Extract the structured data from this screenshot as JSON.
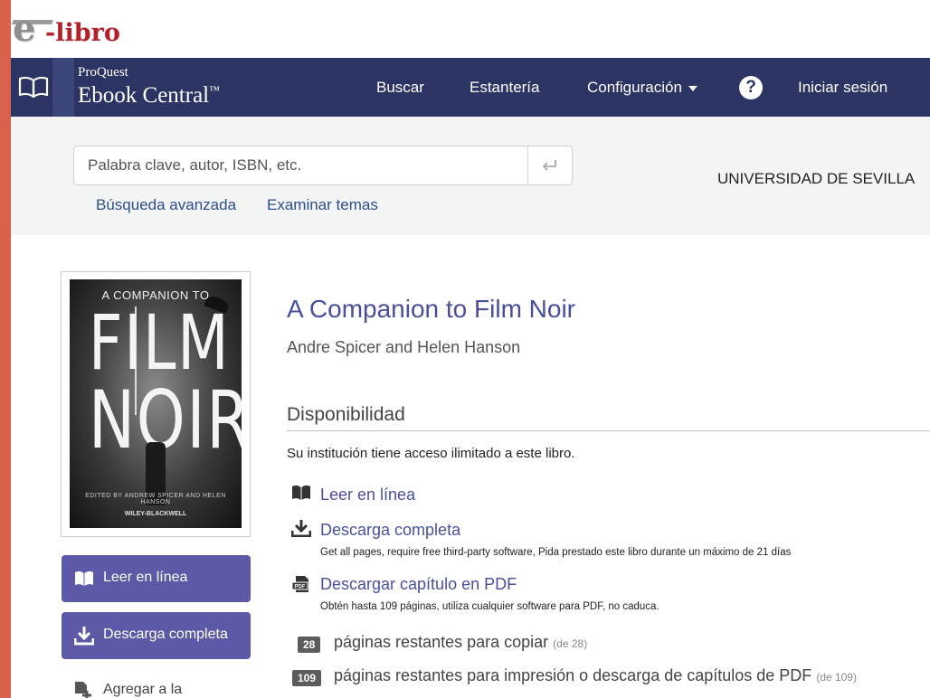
{
  "logo": {
    "letter": "e",
    "text": "-libro"
  },
  "nav": {
    "brand_small": "ProQuest",
    "brand_big": "Ebook Central",
    "trademark": "™",
    "links": [
      "Buscar",
      "Estantería",
      "Configuración",
      "Iniciar sesión"
    ],
    "help_symbol": "?",
    "icons": {
      "library": "open-book-icon",
      "help": "question-circle-icon",
      "dropdown": "caret-down-icon"
    }
  },
  "search": {
    "placeholder": "Palabra clave, autor, ISBN, etc.",
    "value": "",
    "submit_icon": "enter-return-icon",
    "advanced": "Búsqueda avanzada",
    "browse": "Examinar temas"
  },
  "institution": "UNIVERSIDAD DE SEVILLA",
  "cover": {
    "top_line": "A COMPANION TO",
    "line1": "FILM",
    "line2": "NOIR",
    "edited": "EDITED BY ANDREW SPICER AND HELEN HANSON",
    "publisher": "WILEY-BLACKWELL"
  },
  "actions": {
    "read_online": "Leer en línea",
    "download_full": "Descarga completa",
    "add_to": "Agregar a la"
  },
  "book": {
    "title": "A Companion to Film Noir",
    "authors": "Andre Spicer and Helen Hanson"
  },
  "availability": {
    "heading": "Disponibilidad",
    "access_text": "Su institución tiene acceso ilimitado a este libro.",
    "options": [
      {
        "label": "Leer en línea",
        "icon": "book-icon",
        "sub": ""
      },
      {
        "label": "Descarga completa",
        "icon": "download-icon",
        "sub": "Get all pages, require free third-party software, Pida prestado este libro durante un máximo de 21 días"
      },
      {
        "label": "Descargar capítulo en PDF",
        "icon": "pdf-icon",
        "sub": "Obtén hasta 109 páginas, utiliza cualquier software para PDF, no caduca."
      }
    ],
    "copy": {
      "count": "28",
      "text": "páginas restantes para copiar",
      "total": "(de 28)"
    },
    "print": {
      "count": "109",
      "text": "páginas restantes para impresión o descarga de capítulos de PDF",
      "total": "(de 109)"
    }
  },
  "colors": {
    "nav_bg": "#2b3463",
    "accent": "#5c5aa6",
    "link": "#4a4f9a",
    "frame_border": "#d9604a",
    "logo_red": "#b3202a"
  }
}
